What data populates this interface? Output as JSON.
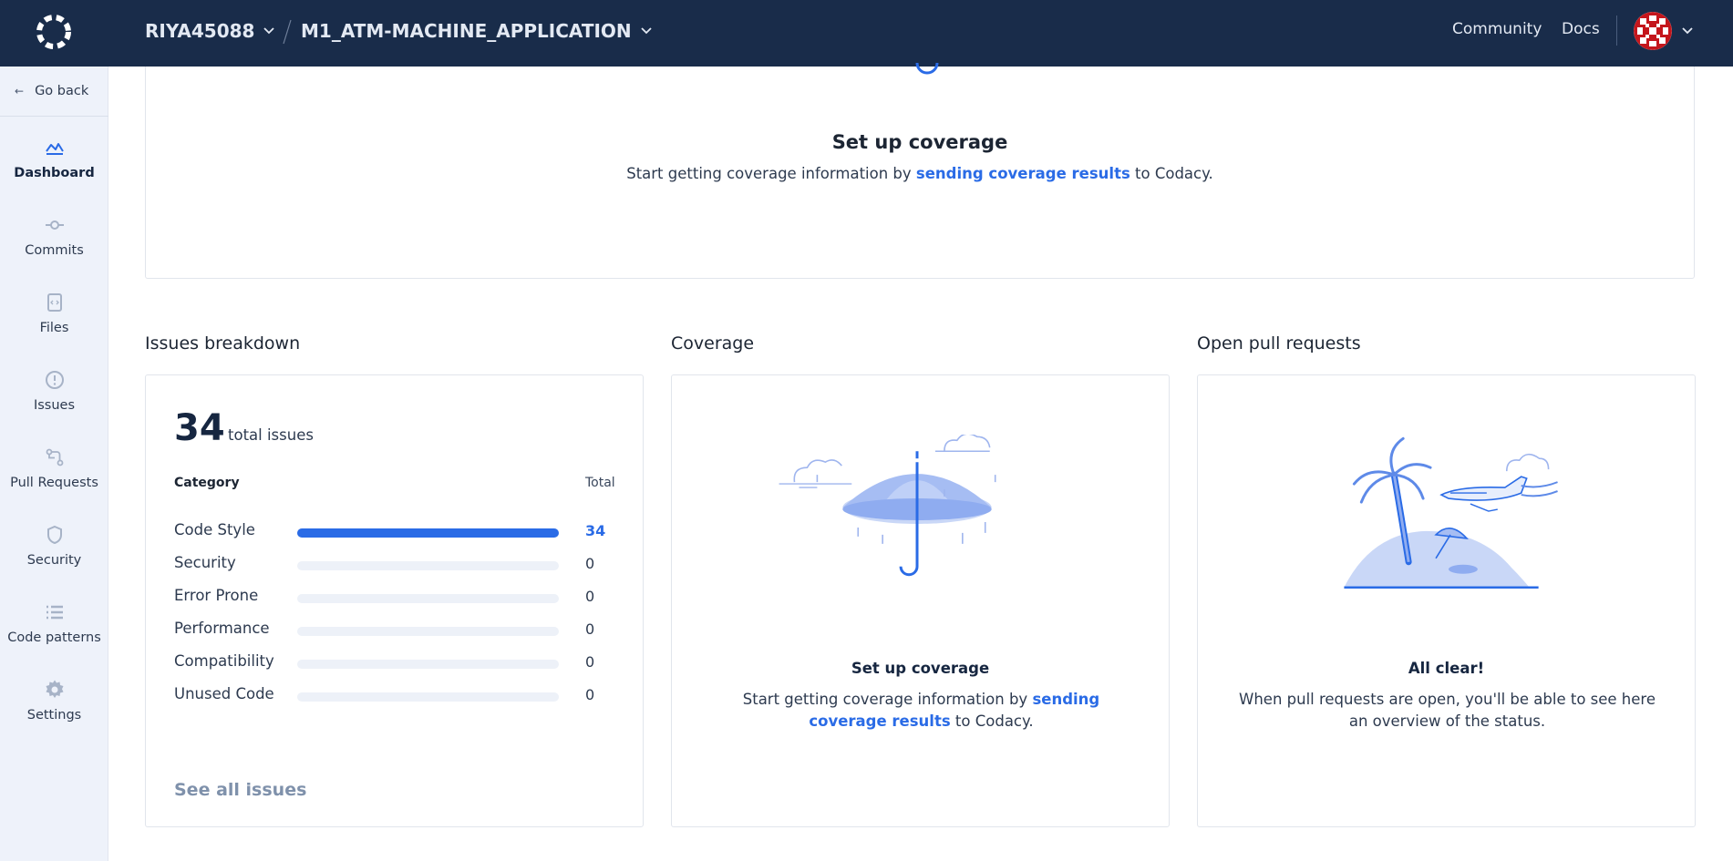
{
  "topbar": {
    "org": "RIYA45088",
    "repo": "M1_ATM-MACHINE_APPLICATION",
    "nav": [
      "Community",
      "Docs"
    ],
    "logo_icon": "codacy-logo-icon",
    "avatar_icon": "user-avatar-icon",
    "colors": {
      "bar": "#192c4a",
      "text": "#e3e9f3"
    }
  },
  "sidebar": {
    "go_back": "Go back",
    "items": [
      {
        "label": "Dashboard",
        "icon": "dashboard-icon",
        "active": true
      },
      {
        "label": "Commits",
        "icon": "commit-icon",
        "active": false
      },
      {
        "label": "Files",
        "icon": "file-icon",
        "active": false
      },
      {
        "label": "Issues",
        "icon": "alert-icon",
        "active": false
      },
      {
        "label": "Pull Requests",
        "icon": "pull-request-icon",
        "active": false
      },
      {
        "label": "Security",
        "icon": "shield-icon",
        "active": false
      },
      {
        "label": "Code patterns",
        "icon": "list-icon",
        "active": false
      },
      {
        "label": "Settings",
        "icon": "gear-icon",
        "active": false
      }
    ]
  },
  "coverage_setup": {
    "title": "Set up coverage",
    "desc_before": "Start getting coverage information by ",
    "link": "sending coverage results",
    "desc_after": " to Codacy."
  },
  "issues": {
    "section_title": "Issues breakdown",
    "total": "34",
    "total_label": "total issues",
    "col_category": "Category",
    "col_total": "Total",
    "rows": [
      {
        "name": "Code Style",
        "value": "34",
        "fraction": 1.0
      },
      {
        "name": "Security",
        "value": "0",
        "fraction": 0
      },
      {
        "name": "Error Prone",
        "value": "0",
        "fraction": 0
      },
      {
        "name": "Performance",
        "value": "0",
        "fraction": 0
      },
      {
        "name": "Compatibility",
        "value": "0",
        "fraction": 0
      },
      {
        "name": "Unused Code",
        "value": "0",
        "fraction": 0
      }
    ],
    "see_all": "See all issues"
  },
  "coverage": {
    "section_title": "Coverage",
    "title": "Set up coverage",
    "desc_before": "Start getting coverage information by ",
    "link": "sending coverage results",
    "desc_after": " to Codacy.",
    "illustration": "umbrella-illustration"
  },
  "pull_requests": {
    "section_title": "Open pull requests",
    "title": "All clear!",
    "desc": "When pull requests are open, you'll be able to see here an overview of the status.",
    "illustration": "island-illustration"
  },
  "colors": {
    "accent": "#2a6be6",
    "muted_link": "#7f91ab",
    "track": "#edf1f8"
  }
}
